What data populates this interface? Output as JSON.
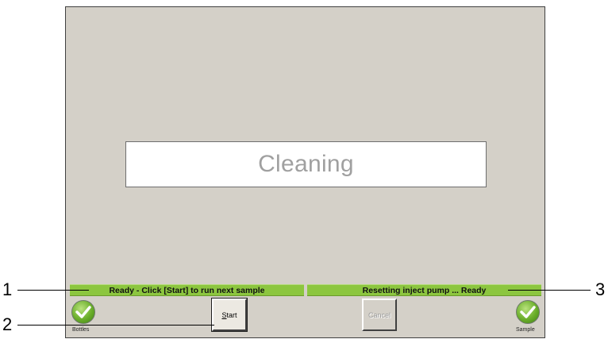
{
  "main": {
    "state_text": "Cleaning"
  },
  "status": {
    "left_message": "Ready - Click [Start] to run next sample",
    "right_message": "Resetting inject pump ... Ready"
  },
  "buttons": {
    "start_label": "Start",
    "start_accesskey": "S",
    "start_rest": "tart",
    "cancel_label": "Cancel"
  },
  "indicators": {
    "left_label": "Bottles",
    "right_label": "Sample",
    "icon": "green-checkmark-icon",
    "color": "#6aae2a"
  },
  "callouts": {
    "one": "1",
    "two": "2",
    "three": "3"
  }
}
